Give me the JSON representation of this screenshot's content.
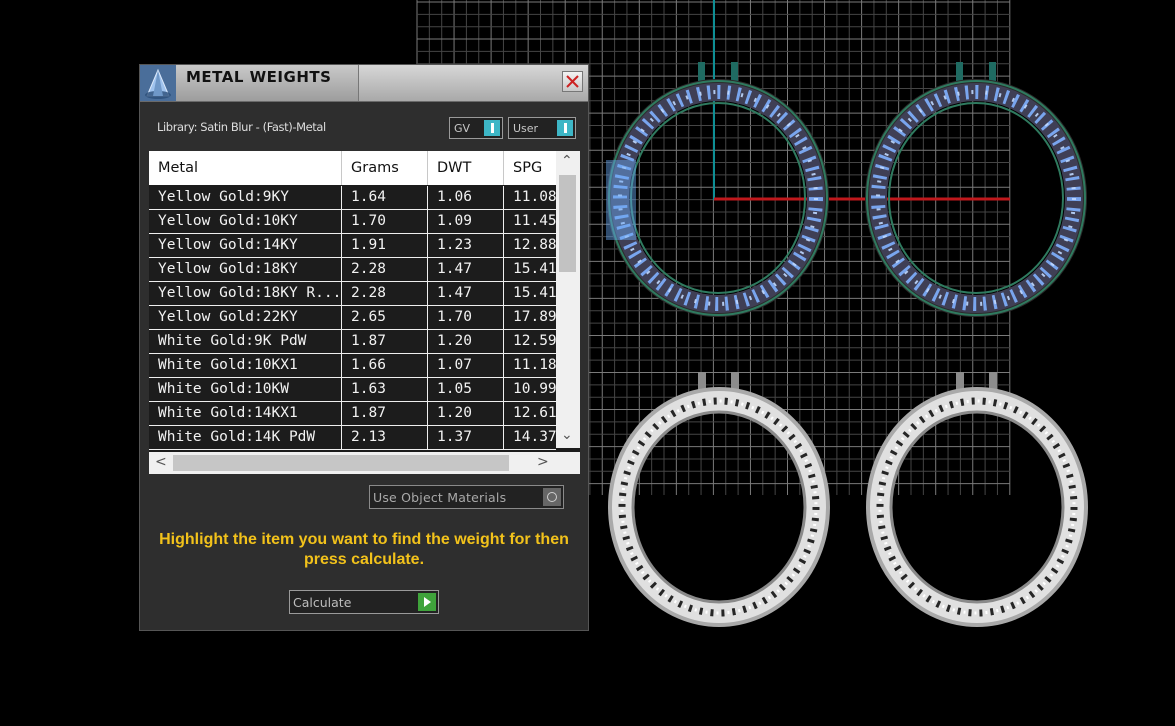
{
  "dialog": {
    "title": "METAL WEIGHTS",
    "close_glyph": "✕",
    "library_label": "Library: Satin Blur - (Fast)-Metal",
    "toggles": [
      {
        "label": "GV",
        "state": "on"
      },
      {
        "label": "User",
        "state": "on"
      }
    ],
    "table": {
      "columns": [
        "Metal",
        "Grams",
        "DWT",
        "SPG"
      ],
      "rows": [
        [
          "Yellow Gold:9KY",
          "1.64",
          "1.06",
          "11.08"
        ],
        [
          "Yellow Gold:10KY",
          "1.70",
          "1.09",
          "11.45"
        ],
        [
          "Yellow Gold:14KY",
          "1.91",
          "1.23",
          "12.88"
        ],
        [
          "Yellow Gold:18KY",
          "2.28",
          "1.47",
          "15.41"
        ],
        [
          "Yellow Gold:18KY R...",
          "2.28",
          "1.47",
          "15.41"
        ],
        [
          "Yellow Gold:22KY",
          "2.65",
          "1.70",
          "17.89"
        ],
        [
          "White Gold:9K PdW",
          "1.87",
          "1.20",
          "12.59"
        ],
        [
          "White Gold:10KX1",
          "1.66",
          "1.07",
          "11.18"
        ],
        [
          "White Gold:10KW",
          "1.63",
          "1.05",
          "10.99"
        ],
        [
          "White Gold:14KX1",
          "1.87",
          "1.20",
          "12.61"
        ],
        [
          "White Gold:14K PdW",
          "2.13",
          "1.37",
          "14.37"
        ]
      ],
      "scroll_up": "⌃",
      "scroll_down": "⌄",
      "scroll_left": "<",
      "scroll_right": ">"
    },
    "use_object_materials": {
      "label": "Use Object Materials",
      "checked": false
    },
    "hint": "Highlight the item you want to find the weight for then press calculate.",
    "calculate_label": "Calculate",
    "icons": [
      "app-logo-icon",
      "close-icon",
      "toggle-icon",
      "radio-icon",
      "play-arrow-icon"
    ]
  },
  "colors": {
    "panel_bg": "#2e2e2e",
    "accent_teal": "#3db6c6",
    "hint_yellow": "#f2c21b",
    "go_green": "#3fa33b",
    "gem_blue": "#6aaaf5",
    "metal_silver": "#c8c8c8"
  }
}
